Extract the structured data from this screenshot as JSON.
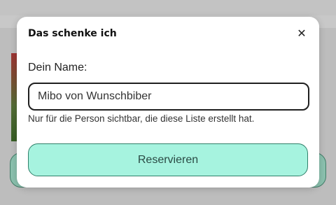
{
  "dialog": {
    "title": "Das schenke ich",
    "close_icon": "close-icon",
    "close_glyph": "✕",
    "name_label": "Dein Name:",
    "name_value": "Mibo von Wunschbiber",
    "hint": "Nur für die Person sichtbar, die diese Liste erstellt hat.",
    "submit_label": "Reservieren"
  },
  "colors": {
    "accent": "#a6f3df",
    "accent_border": "#2f7f69"
  }
}
